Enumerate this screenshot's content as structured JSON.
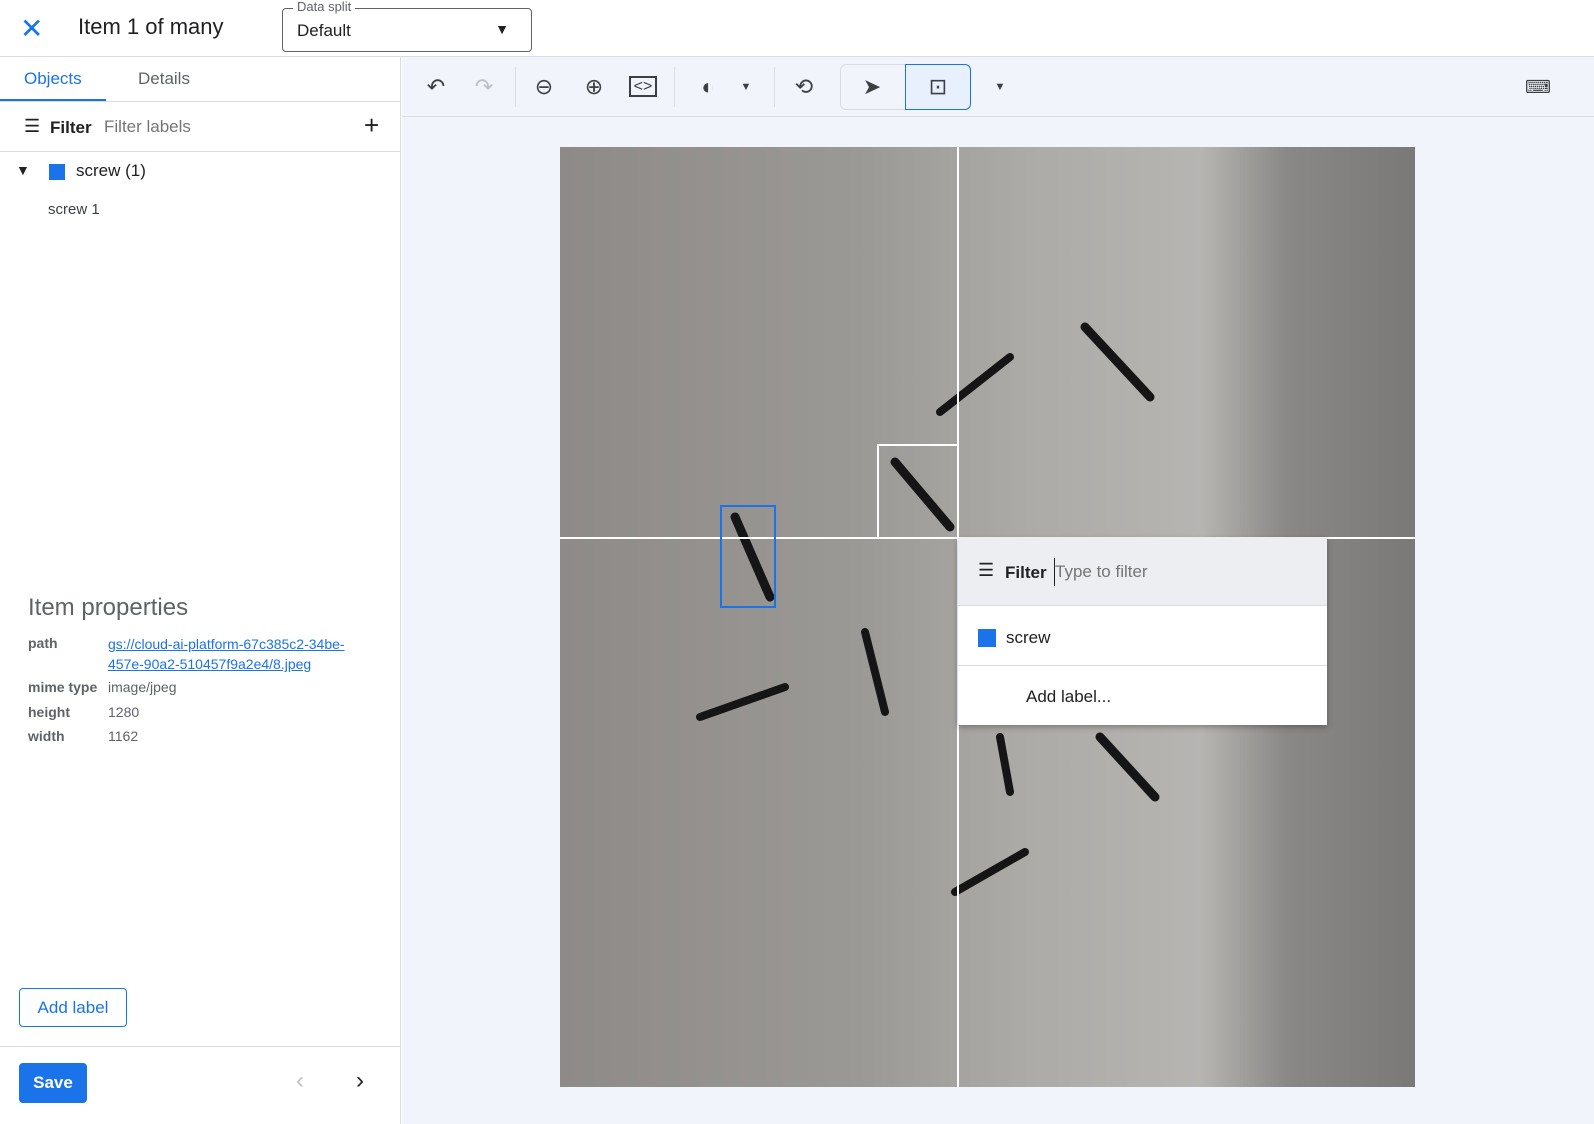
{
  "header": {
    "title": "Item 1 of many",
    "data_split_label": "Data split",
    "data_split_value": "Default"
  },
  "sidebar": {
    "tabs": [
      {
        "label": "Objects"
      },
      {
        "label": "Details"
      }
    ],
    "filter_label": "Filter",
    "filter_placeholder": "Filter labels",
    "groups": [
      {
        "label": "screw (1)",
        "color": "#1a73e8",
        "items": [
          "screw 1"
        ]
      }
    ],
    "item_properties": {
      "title": "Item properties",
      "path_key": "path",
      "path": "gs://cloud-ai-platform-67c385c2-34be-457e-90a2-510457f9a2e4/8.jpeg",
      "mime_key": "mime type",
      "mime": "image/jpeg",
      "height_key": "height",
      "height": "1280",
      "width_key": "width",
      "width": "1162"
    },
    "add_label": "Add label",
    "save": "Save"
  },
  "popup": {
    "filter_label": "Filter",
    "placeholder": "Type to filter",
    "options": [
      {
        "label": "screw",
        "color": "#1a73e8"
      }
    ],
    "add_label": "Add label..."
  }
}
